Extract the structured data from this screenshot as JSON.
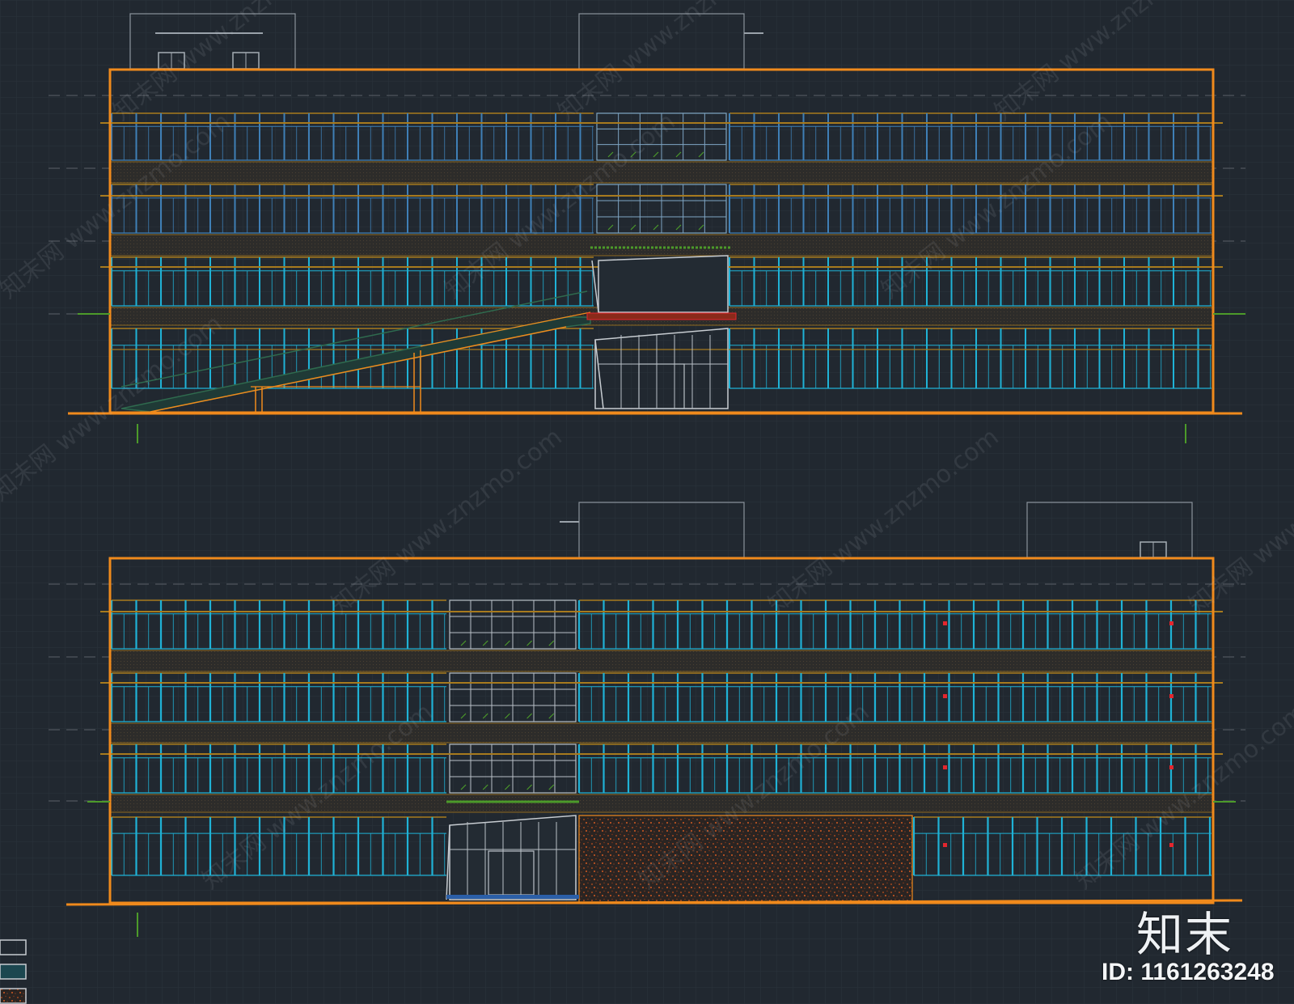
{
  "colors": {
    "background": "#212830",
    "grid": "#2b333c",
    "outline": "#f08a1c",
    "band": "#a77a1e",
    "frame_cyan": "#1fb2d6",
    "frame_blue": "#3f7fb6",
    "frame_light": "#7fa6c4",
    "glass_white": "#b9c0c7",
    "slab": "#2d2c2a",
    "green": "#4c9a2a",
    "red": "#e3262e",
    "stone": "#b84e22"
  },
  "watermark": {
    "logo": "知末",
    "id_text": "ID: 1161263248",
    "repeated_text": "知末网 www.znzmo.com"
  },
  "drawing": {
    "elevations": [
      {
        "name": "front",
        "has_stair": true,
        "entrance": "center"
      },
      {
        "name": "rear",
        "has_stair": false,
        "entrance": "left-center",
        "stone_panel": true
      }
    ],
    "legend_swatches": [
      {
        "icon": "white-outline-swatch"
      },
      {
        "icon": "cyan-swatch"
      },
      {
        "icon": "stone-hatch-swatch"
      }
    ]
  }
}
